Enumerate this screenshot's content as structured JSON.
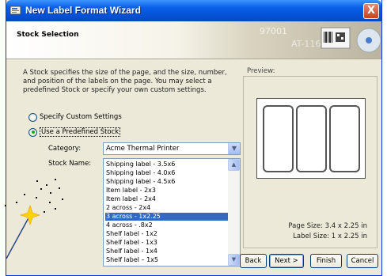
{
  "window": {
    "title": "New Label Format Wizard",
    "close_label": "X"
  },
  "header": {
    "title": "Stock Selection",
    "art_text": "97001  AT-116"
  },
  "description": "A Stock specifies the size of the page, and the size, number, and position of the labels on the page. You may select a predefined Stock or specify your own custom settings.",
  "options": {
    "custom": {
      "label": "Specify Custom Settings",
      "selected": false
    },
    "predefined": {
      "label": "Use a Predefined Stock",
      "selected": true
    }
  },
  "category": {
    "label": "Category:",
    "value": "Acme Thermal Printer"
  },
  "stock_name": {
    "label": "Stock Name:",
    "items": [
      "Shipping label - 3.5x6",
      "Shipping label - 4.0x6",
      "Shipping label - 4.5x6",
      "Item label - 2x3",
      "Item label - 2x4",
      "2 across - 2x4",
      "3 across - 1x2.25",
      "4 across - .8x2",
      "Shelf label - 1x2",
      "Shelf label - 1x3",
      "Shelf label - 1x4",
      "Shelf label – 1x5"
    ],
    "selected_index": 6
  },
  "preview": {
    "label": "Preview:",
    "labels_across": 3,
    "page_size": "Page Size:  3.4 x 2.25 in",
    "label_size": "Label Size:  1 x 2.25 in"
  },
  "buttons": {
    "back": "Back",
    "next": "Next >",
    "finish": "Finish",
    "cancel": "Cancel"
  },
  "colors": {
    "titlebar": "#0553d8",
    "selection": "#316ac5",
    "dialog_bg": "#ece9d8"
  }
}
